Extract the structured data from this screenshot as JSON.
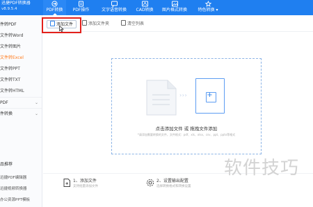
{
  "app": {
    "title": "迅捷PDF转换器",
    "version": "v8.9.5.4"
  },
  "nav": {
    "items": [
      {
        "label": "PDF转换",
        "icon": "pdf-convert-icon"
      },
      {
        "label": "PDF操作",
        "icon": "pdf-operate-icon"
      },
      {
        "label": "文字语音转换",
        "icon": "text-speech-icon"
      },
      {
        "label": "CAD转换",
        "icon": "cad-icon"
      },
      {
        "label": "图片格式转换",
        "icon": "image-format-icon"
      },
      {
        "label": "特色转换",
        "icon": "special-convert-icon"
      }
    ],
    "active_index": 0
  },
  "sidebar": {
    "section_title": "件转PDF",
    "items": [
      {
        "label": "文件转Word"
      },
      {
        "label": "文件转图片"
      },
      {
        "label": "文件转Excel",
        "active": true
      },
      {
        "label": "文件转PPT"
      },
      {
        "label": "文件转TXT"
      },
      {
        "label": "文件转HTML"
      }
    ],
    "groups": [
      {
        "label": "PDF"
      },
      {
        "label": "件转换"
      }
    ],
    "recommend_title": "品推荐",
    "recommend_items": [
      {
        "label": "迅捷PDF编辑器"
      },
      {
        "label": "迅捷视频转换器"
      },
      {
        "label": "办公资源PPT模板"
      }
    ]
  },
  "toolbar": {
    "add_file": "添加文件",
    "add_folder": "添加文件夹",
    "clear_list": "清空列表"
  },
  "dropzone": {
    "title": "点击添加文件 或 拖拽文件添加",
    "subtitle": "*请添加需要转换的文件，文件格式：pdf、xls、xlsx、csv、ppt、pptx等格式",
    "arrows": "› › ›",
    "plus": "+"
  },
  "steps": [
    {
      "title": "1、添加文件",
      "subtitle": "支持批量添加文件"
    },
    {
      "title": "2、设置输出配置",
      "subtitle": "选择转换格式和转换设置"
    }
  ],
  "watermark": "软件技巧",
  "colors": {
    "header_blue": "#1f7ff0",
    "highlight_red": "#e3201b",
    "active_orange": "#ff7a1a",
    "dropzone_border": "#8cb4e6"
  }
}
